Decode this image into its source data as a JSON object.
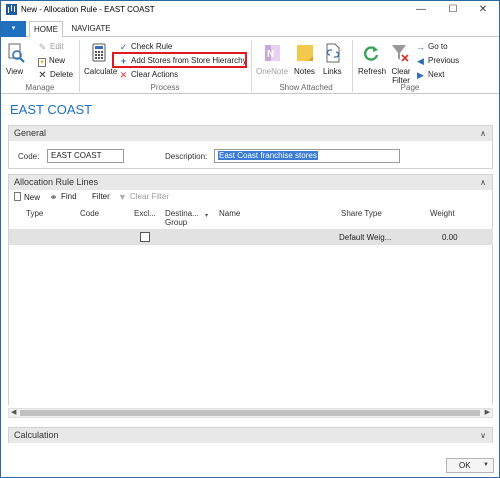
{
  "window": {
    "title": "New - Allocation Rule - EAST COAST",
    "minimize": "—",
    "maximize": "☐",
    "close": "✕"
  },
  "ribbon_tabs": {
    "file_arrow": "▾",
    "home": "HOME",
    "navigate": "NAVIGATE"
  },
  "ribbon": {
    "manage": {
      "label": "Manage",
      "view": "View",
      "edit": "Edit",
      "new": "New",
      "delete": "Delete"
    },
    "process": {
      "label": "Process",
      "calculate": "Calculate",
      "check_rule": "Check Rule",
      "add_stores": "Add Stores from Store Hierarchy",
      "clear_actions": "Clear Actions"
    },
    "show_attached": {
      "label": "Show Attached",
      "onenote": "OneNote",
      "notes": "Notes",
      "links": "Links"
    },
    "page": {
      "label": "Page",
      "refresh": "Refresh",
      "clear_filter": "Clear Filter",
      "goto": "Go to",
      "previous": "Previous",
      "next": "Next"
    }
  },
  "page_title": "EAST COAST",
  "general": {
    "header": "General",
    "code_label": "Code:",
    "code_value": "EAST COAST",
    "description_label": "Description:",
    "description_value": "East Coast franchise stores"
  },
  "lines": {
    "header": "Allocation Rule Lines",
    "toolbar": {
      "new": "New",
      "find": "Find",
      "filter": "Filter",
      "clear_filter": "Clear Filter"
    },
    "columns": [
      "Type",
      "Code",
      "Excl...",
      "Destina...",
      "Group",
      "Name",
      "Share Type",
      "Weight"
    ],
    "rows": [
      {
        "type": "",
        "code": "",
        "excluded": false,
        "destination_group": "",
        "name": "",
        "share_type": "Default Weig...",
        "weight": "0.00"
      }
    ]
  },
  "calculation": {
    "header": "Calculation"
  },
  "footer": {
    "ok": "OK"
  },
  "colors": {
    "accent": "#1f6fbf",
    "highlight_border": "#e0191e"
  }
}
